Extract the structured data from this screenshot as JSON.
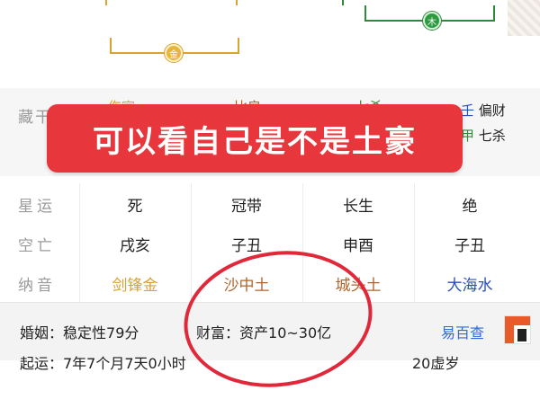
{
  "top_diagram": {
    "gold_node_label": "金",
    "green_node_label": "木",
    "colors": {
      "gold": "#d9a233",
      "green": "#2f8a3a"
    }
  },
  "canggan": {
    "label": "藏干",
    "right_top": {
      "stem": "壬",
      "god": "偏财"
    },
    "right_bottom": {
      "stem": "甲",
      "god": "七杀"
    },
    "partial_top": [
      "伤官",
      "比肩",
      "七杀"
    ]
  },
  "banner": {
    "text": "可以看自己是不是土豪",
    "color": "#e8373c"
  },
  "table": {
    "rows": [
      {
        "label": "星运",
        "cells": [
          "死",
          "冠带",
          "长生",
          "绝"
        ]
      },
      {
        "label": "空亡",
        "cells": [
          "戌亥",
          "子丑",
          "申酉",
          "子丑"
        ]
      },
      {
        "label": "纳音",
        "cells": [
          "剑锋金",
          "沙中土",
          "城头土",
          "大海水"
        ]
      }
    ],
    "nayin_colors": [
      "#d9a233",
      "#b0632a",
      "#b0632a",
      "#2b4fb7"
    ]
  },
  "bottom": {
    "marriage_label": "婚姻：",
    "marriage_value": "稳定性79分",
    "wealth_label": "财富：",
    "wealth_value": "资产10~30亿",
    "brand": "易百查",
    "second_row_left": "起运：7年7个月7天0小时",
    "second_row_right": "20虚岁"
  },
  "annotation": {
    "ring_color": "#e0283a"
  }
}
